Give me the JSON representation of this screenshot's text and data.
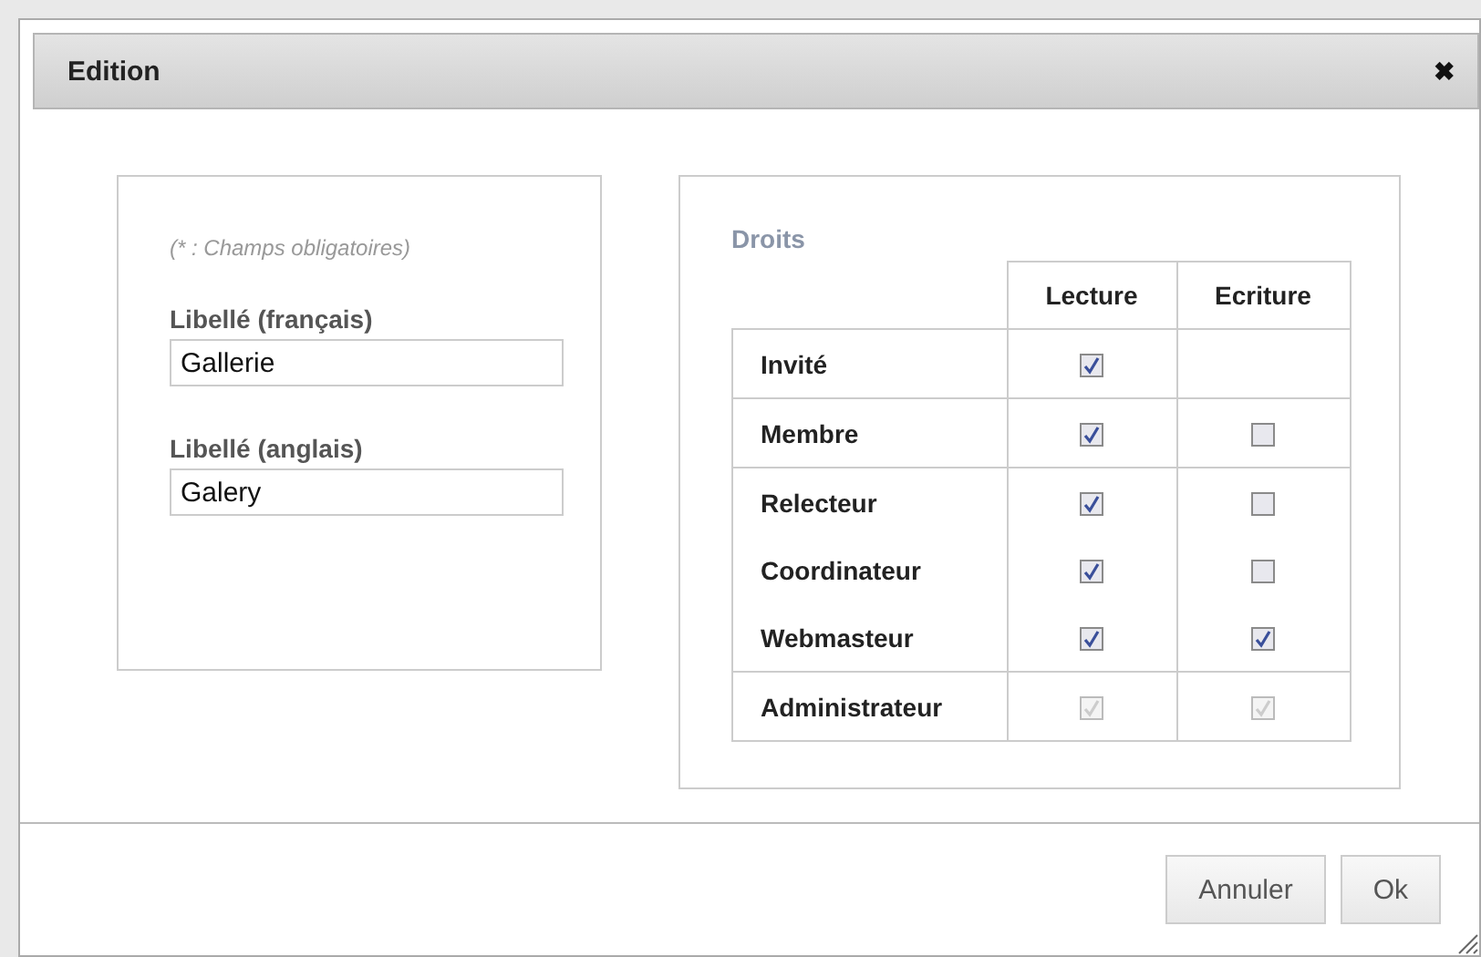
{
  "window": {
    "title": "Edition",
    "close": "✖"
  },
  "form": {
    "note": "(* : Champs obligatoires)",
    "fields": [
      {
        "label": "Libellé (français)",
        "value": "Gallerie"
      },
      {
        "label": "Libellé (anglais)",
        "value": "Galery"
      }
    ]
  },
  "rights": {
    "title": "Droits",
    "columns": [
      "Lecture",
      "Ecriture"
    ],
    "rows": [
      {
        "name": "Invité",
        "line_above": true,
        "cells": [
          {
            "checked": true,
            "disabled": false
          },
          null
        ]
      },
      {
        "name": "Membre",
        "line_above": true,
        "cells": [
          {
            "checked": true,
            "disabled": false
          },
          {
            "checked": false,
            "disabled": false
          }
        ]
      },
      {
        "name": "Relecteur",
        "line_above": true,
        "cells": [
          {
            "checked": true,
            "disabled": false
          },
          {
            "checked": false,
            "disabled": false
          }
        ]
      },
      {
        "name": "Coordinateur",
        "line_above": false,
        "cells": [
          {
            "checked": true,
            "disabled": false
          },
          {
            "checked": false,
            "disabled": false
          }
        ]
      },
      {
        "name": "Webmasteur",
        "line_above": false,
        "cells": [
          {
            "checked": true,
            "disabled": false
          },
          {
            "checked": true,
            "disabled": false
          }
        ]
      },
      {
        "name": "Administrateur",
        "line_above": true,
        "cells": [
          {
            "checked": true,
            "disabled": true
          },
          {
            "checked": true,
            "disabled": true
          }
        ]
      }
    ]
  },
  "buttons": [
    "Annuler",
    "Ok"
  ]
}
